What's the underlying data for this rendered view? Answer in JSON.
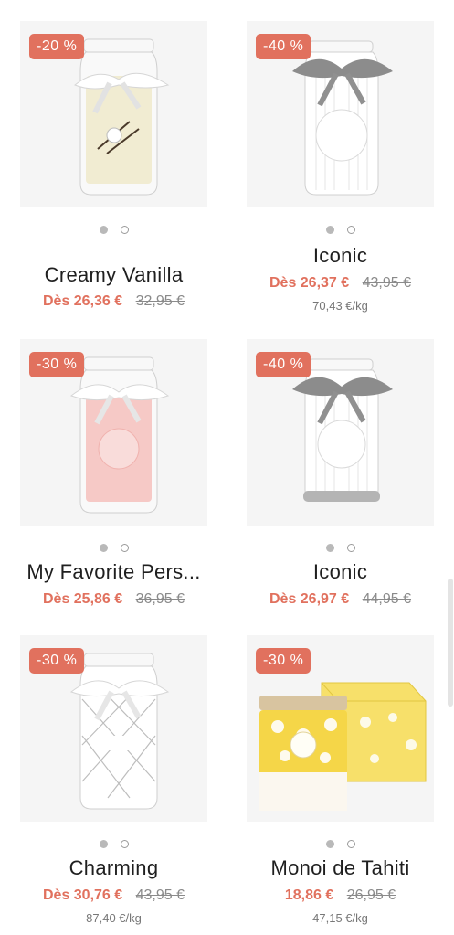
{
  "products": [
    {
      "name": "Creamy Vanilla",
      "discount": "-20 %",
      "price": "Dès 26,36 €",
      "old_price": "32,95 €",
      "unit_price": "",
      "image_icon": "candle-jar-vanilla-icon"
    },
    {
      "name": "Iconic",
      "discount": "-40 %",
      "price": "Dès 26,37 €",
      "old_price": "43,95 €",
      "unit_price": "70,43 €/kg",
      "image_icon": "candle-jar-iconic-icon"
    },
    {
      "name": "My Favorite Pers...",
      "discount": "-30 %",
      "price": "Dès 25,86 €",
      "old_price": "36,95 €",
      "unit_price": "",
      "image_icon": "candle-jar-pink-icon"
    },
    {
      "name": "Iconic",
      "discount": "-40 %",
      "price": "Dès 26,97 €",
      "old_price": "44,95 €",
      "unit_price": "",
      "image_icon": "candle-jar-iconic-icon"
    },
    {
      "name": "Charming",
      "discount": "-30 %",
      "price": "Dès 30,76 €",
      "old_price": "43,95 €",
      "unit_price": "87,40 €/kg",
      "image_icon": "candle-jar-charming-icon"
    },
    {
      "name": "Monoi de Tahiti",
      "discount": "-30 %",
      "price": "18,86 €",
      "old_price": "26,95 €",
      "unit_price": "47,15 €/kg",
      "image_icon": "candle-with-box-icon"
    }
  ],
  "colors": {
    "accent": "#e1715e",
    "image_bg": "#f5f5f5",
    "text": "#1f1f1f"
  }
}
